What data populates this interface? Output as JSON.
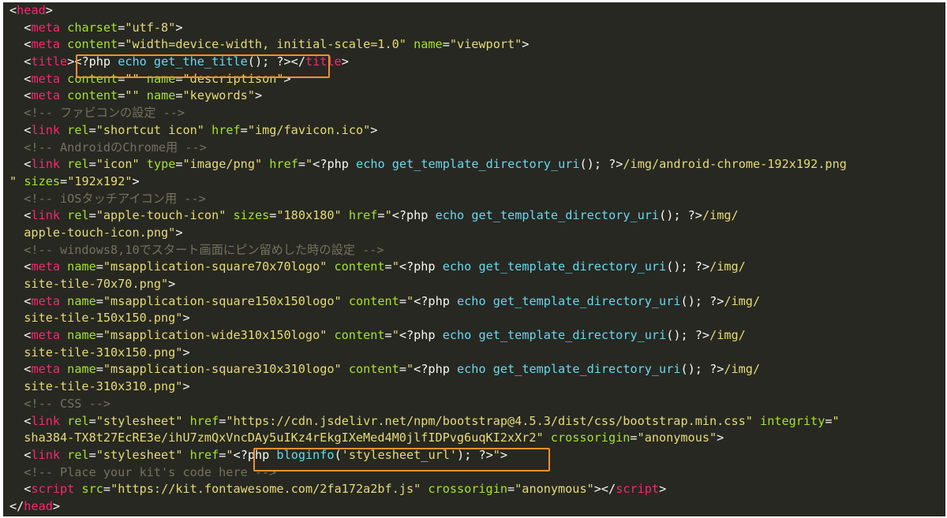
{
  "editor": {
    "lines": [
      [
        {
          "k": "p",
          "v": "<"
        },
        {
          "k": "t",
          "v": "head"
        },
        {
          "k": "p",
          "v": ">"
        }
      ],
      [
        {
          "k": "p",
          "v": "  <"
        },
        {
          "k": "t",
          "v": "meta"
        },
        {
          "k": "p",
          "v": " "
        },
        {
          "k": "a",
          "v": "charset"
        },
        {
          "k": "p",
          "v": "="
        },
        {
          "k": "s",
          "v": "\"utf-8\""
        },
        {
          "k": "p",
          "v": ">"
        }
      ],
      [
        {
          "k": "p",
          "v": "  <"
        },
        {
          "k": "t",
          "v": "meta"
        },
        {
          "k": "p",
          "v": " "
        },
        {
          "k": "a",
          "v": "content"
        },
        {
          "k": "p",
          "v": "="
        },
        {
          "k": "s",
          "v": "\"width=device-width, initial-scale=1.0\""
        },
        {
          "k": "p",
          "v": " "
        },
        {
          "k": "a",
          "v": "name"
        },
        {
          "k": "p",
          "v": "="
        },
        {
          "k": "s",
          "v": "\"viewport\""
        },
        {
          "k": "p",
          "v": ">"
        }
      ],
      [
        {
          "k": "p",
          "v": "  <"
        },
        {
          "k": "t",
          "v": "title"
        },
        {
          "k": "p",
          "v": ">"
        },
        {
          "k": "p",
          "v": "<?php "
        },
        {
          "k": "f",
          "v": "echo"
        },
        {
          "k": "p",
          "v": " "
        },
        {
          "k": "f",
          "v": "get_the_title"
        },
        {
          "k": "p",
          "v": "(); ?>"
        },
        {
          "k": "p",
          "v": "</"
        },
        {
          "k": "t",
          "v": "title"
        },
        {
          "k": "p",
          "v": ">"
        }
      ],
      [
        {
          "k": "p",
          "v": "  <"
        },
        {
          "k": "t",
          "v": "meta"
        },
        {
          "k": "p",
          "v": " "
        },
        {
          "k": "a",
          "v": "content"
        },
        {
          "k": "p",
          "v": "="
        },
        {
          "k": "s",
          "v": "\"\""
        },
        {
          "k": "p",
          "v": " "
        },
        {
          "k": "a",
          "v": "name"
        },
        {
          "k": "p",
          "v": "="
        },
        {
          "k": "s",
          "v": "\"descriptison\""
        },
        {
          "k": "p",
          "v": ">"
        }
      ],
      [
        {
          "k": "p",
          "v": "  <"
        },
        {
          "k": "t",
          "v": "meta"
        },
        {
          "k": "p",
          "v": " "
        },
        {
          "k": "a",
          "v": "content"
        },
        {
          "k": "p",
          "v": "="
        },
        {
          "k": "s",
          "v": "\"\""
        },
        {
          "k": "p",
          "v": " "
        },
        {
          "k": "a",
          "v": "name"
        },
        {
          "k": "p",
          "v": "="
        },
        {
          "k": "s",
          "v": "\"keywords\""
        },
        {
          "k": "p",
          "v": ">"
        }
      ],
      [
        {
          "k": "c",
          "v": "  <!-- ファビコンの設定 -->"
        }
      ],
      [
        {
          "k": "p",
          "v": "  <"
        },
        {
          "k": "t",
          "v": "link"
        },
        {
          "k": "p",
          "v": " "
        },
        {
          "k": "a",
          "v": "rel"
        },
        {
          "k": "p",
          "v": "="
        },
        {
          "k": "s",
          "v": "\"shortcut icon\""
        },
        {
          "k": "p",
          "v": " "
        },
        {
          "k": "a",
          "v": "href"
        },
        {
          "k": "p",
          "v": "="
        },
        {
          "k": "s",
          "v": "\"img/favicon.ico\""
        },
        {
          "k": "p",
          "v": ">"
        }
      ],
      [
        {
          "k": "c",
          "v": "  <!-- AndroidのChrome用 -->"
        }
      ],
      [
        {
          "k": "p",
          "v": "  <"
        },
        {
          "k": "t",
          "v": "link"
        },
        {
          "k": "p",
          "v": " "
        },
        {
          "k": "a",
          "v": "rel"
        },
        {
          "k": "p",
          "v": "="
        },
        {
          "k": "s",
          "v": "\"icon\""
        },
        {
          "k": "p",
          "v": " "
        },
        {
          "k": "a",
          "v": "type"
        },
        {
          "k": "p",
          "v": "="
        },
        {
          "k": "s",
          "v": "\"image/png\""
        },
        {
          "k": "p",
          "v": " "
        },
        {
          "k": "a",
          "v": "href"
        },
        {
          "k": "p",
          "v": "="
        },
        {
          "k": "s",
          "v": "\""
        },
        {
          "k": "p",
          "v": "<?php "
        },
        {
          "k": "f",
          "v": "echo"
        },
        {
          "k": "p",
          "v": " "
        },
        {
          "k": "f",
          "v": "get_template_directory_uri"
        },
        {
          "k": "p",
          "v": "(); ?>"
        },
        {
          "k": "s",
          "v": "/img/android-chrome-192x192.png"
        }
      ],
      [
        {
          "k": "s",
          "v": "\""
        },
        {
          "k": "p",
          "v": " "
        },
        {
          "k": "a",
          "v": "sizes"
        },
        {
          "k": "p",
          "v": "="
        },
        {
          "k": "s",
          "v": "\"192x192\""
        },
        {
          "k": "p",
          "v": ">"
        }
      ],
      [
        {
          "k": "c",
          "v": "  <!-- iOSタッチアイコン用 -->"
        }
      ],
      [
        {
          "k": "p",
          "v": "  <"
        },
        {
          "k": "t",
          "v": "link"
        },
        {
          "k": "p",
          "v": " "
        },
        {
          "k": "a",
          "v": "rel"
        },
        {
          "k": "p",
          "v": "="
        },
        {
          "k": "s",
          "v": "\"apple-touch-icon\""
        },
        {
          "k": "p",
          "v": " "
        },
        {
          "k": "a",
          "v": "sizes"
        },
        {
          "k": "p",
          "v": "="
        },
        {
          "k": "s",
          "v": "\"180x180\""
        },
        {
          "k": "p",
          "v": " "
        },
        {
          "k": "a",
          "v": "href"
        },
        {
          "k": "p",
          "v": "="
        },
        {
          "k": "s",
          "v": "\""
        },
        {
          "k": "p",
          "v": "<?php "
        },
        {
          "k": "f",
          "v": "echo"
        },
        {
          "k": "p",
          "v": " "
        },
        {
          "k": "f",
          "v": "get_template_directory_uri"
        },
        {
          "k": "p",
          "v": "(); ?>"
        },
        {
          "k": "s",
          "v": "/img/"
        }
      ],
      [
        {
          "k": "s",
          "v": "  apple-touch-icon.png\""
        },
        {
          "k": "p",
          "v": ">"
        }
      ],
      [
        {
          "k": "c",
          "v": "  <!-- windows8,10でスタート画面にピン留めした時の設定 -->"
        }
      ],
      [
        {
          "k": "p",
          "v": "  <"
        },
        {
          "k": "t",
          "v": "meta"
        },
        {
          "k": "p",
          "v": " "
        },
        {
          "k": "a",
          "v": "name"
        },
        {
          "k": "p",
          "v": "="
        },
        {
          "k": "s",
          "v": "\"msapplication-square70x70logo\""
        },
        {
          "k": "p",
          "v": " "
        },
        {
          "k": "a",
          "v": "content"
        },
        {
          "k": "p",
          "v": "="
        },
        {
          "k": "s",
          "v": "\""
        },
        {
          "k": "p",
          "v": "<?php "
        },
        {
          "k": "f",
          "v": "echo"
        },
        {
          "k": "p",
          "v": " "
        },
        {
          "k": "f",
          "v": "get_template_directory_uri"
        },
        {
          "k": "p",
          "v": "(); ?>"
        },
        {
          "k": "s",
          "v": "/img/"
        }
      ],
      [
        {
          "k": "s",
          "v": "  site-tile-70x70.png\""
        },
        {
          "k": "p",
          "v": ">"
        }
      ],
      [
        {
          "k": "p",
          "v": "  <"
        },
        {
          "k": "t",
          "v": "meta"
        },
        {
          "k": "p",
          "v": " "
        },
        {
          "k": "a",
          "v": "name"
        },
        {
          "k": "p",
          "v": "="
        },
        {
          "k": "s",
          "v": "\"msapplication-square150x150logo\""
        },
        {
          "k": "p",
          "v": " "
        },
        {
          "k": "a",
          "v": "content"
        },
        {
          "k": "p",
          "v": "="
        },
        {
          "k": "s",
          "v": "\""
        },
        {
          "k": "p",
          "v": "<?php "
        },
        {
          "k": "f",
          "v": "echo"
        },
        {
          "k": "p",
          "v": " "
        },
        {
          "k": "f",
          "v": "get_template_directory_uri"
        },
        {
          "k": "p",
          "v": "(); ?>"
        },
        {
          "k": "s",
          "v": "/img/"
        }
      ],
      [
        {
          "k": "s",
          "v": "  site-tile-150x150.png\""
        },
        {
          "k": "p",
          "v": ">"
        }
      ],
      [
        {
          "k": "p",
          "v": "  <"
        },
        {
          "k": "t",
          "v": "meta"
        },
        {
          "k": "p",
          "v": " "
        },
        {
          "k": "a",
          "v": "name"
        },
        {
          "k": "p",
          "v": "="
        },
        {
          "k": "s",
          "v": "\"msapplication-wide310x150logo\""
        },
        {
          "k": "p",
          "v": " "
        },
        {
          "k": "a",
          "v": "content"
        },
        {
          "k": "p",
          "v": "="
        },
        {
          "k": "s",
          "v": "\""
        },
        {
          "k": "p",
          "v": "<?php "
        },
        {
          "k": "f",
          "v": "echo"
        },
        {
          "k": "p",
          "v": " "
        },
        {
          "k": "f",
          "v": "get_template_directory_uri"
        },
        {
          "k": "p",
          "v": "(); ?>"
        },
        {
          "k": "s",
          "v": "/img/"
        }
      ],
      [
        {
          "k": "s",
          "v": "  site-tile-310x150.png\""
        },
        {
          "k": "p",
          "v": ">"
        }
      ],
      [
        {
          "k": "p",
          "v": "  <"
        },
        {
          "k": "t",
          "v": "meta"
        },
        {
          "k": "p",
          "v": " "
        },
        {
          "k": "a",
          "v": "name"
        },
        {
          "k": "p",
          "v": "="
        },
        {
          "k": "s",
          "v": "\"msapplication-square310x310logo\""
        },
        {
          "k": "p",
          "v": " "
        },
        {
          "k": "a",
          "v": "content"
        },
        {
          "k": "p",
          "v": "="
        },
        {
          "k": "s",
          "v": "\""
        },
        {
          "k": "p",
          "v": "<?php "
        },
        {
          "k": "f",
          "v": "echo"
        },
        {
          "k": "p",
          "v": " "
        },
        {
          "k": "f",
          "v": "get_template_directory_uri"
        },
        {
          "k": "p",
          "v": "(); ?>"
        },
        {
          "k": "s",
          "v": "/img/"
        }
      ],
      [
        {
          "k": "s",
          "v": "  site-tile-310x310.png\""
        },
        {
          "k": "p",
          "v": ">"
        }
      ],
      [
        {
          "k": "c",
          "v": "  <!-- CSS -->"
        }
      ],
      [
        {
          "k": "p",
          "v": "  <"
        },
        {
          "k": "t",
          "v": "link"
        },
        {
          "k": "p",
          "v": " "
        },
        {
          "k": "a",
          "v": "rel"
        },
        {
          "k": "p",
          "v": "="
        },
        {
          "k": "s",
          "v": "\"stylesheet\""
        },
        {
          "k": "p",
          "v": " "
        },
        {
          "k": "a",
          "v": "href"
        },
        {
          "k": "p",
          "v": "="
        },
        {
          "k": "s",
          "v": "\"https://cdn.jsdelivr.net/npm/bootstrap@4.5.3/dist/css/bootstrap.min.css\""
        },
        {
          "k": "p",
          "v": " "
        },
        {
          "k": "a",
          "v": "integrity"
        },
        {
          "k": "p",
          "v": "="
        },
        {
          "k": "s",
          "v": "\""
        }
      ],
      [
        {
          "k": "s",
          "v": "  sha384-TX8t27EcRE3e/ihU7zmQxVncDAy5uIKz4rEkgIXeMed4M0jlfIDPvg6uqKI2xXr2\""
        },
        {
          "k": "p",
          "v": " "
        },
        {
          "k": "a",
          "v": "crossorigin"
        },
        {
          "k": "p",
          "v": "="
        },
        {
          "k": "s",
          "v": "\"anonymous\""
        },
        {
          "k": "p",
          "v": ">"
        }
      ],
      [
        {
          "k": "p",
          "v": "  <"
        },
        {
          "k": "t",
          "v": "link"
        },
        {
          "k": "p",
          "v": " "
        },
        {
          "k": "a",
          "v": "rel"
        },
        {
          "k": "p",
          "v": "="
        },
        {
          "k": "s",
          "v": "\"stylesheet\""
        },
        {
          "k": "p",
          "v": " "
        },
        {
          "k": "a",
          "v": "href"
        },
        {
          "k": "p",
          "v": "="
        },
        {
          "k": "s",
          "v": "\""
        },
        {
          "k": "p",
          "v": "<?php "
        },
        {
          "k": "f",
          "v": "bloginfo"
        },
        {
          "k": "p",
          "v": "("
        },
        {
          "k": "s",
          "v": "'stylesheet_url'"
        },
        {
          "k": "p",
          "v": "); ?>"
        },
        {
          "k": "s",
          "v": "\""
        },
        {
          "k": "p",
          "v": ">"
        }
      ],
      [
        {
          "k": "c",
          "v": "  <!-- Place your kit's code here -->"
        }
      ],
      [
        {
          "k": "p",
          "v": "  <"
        },
        {
          "k": "t",
          "v": "script"
        },
        {
          "k": "p",
          "v": " "
        },
        {
          "k": "a",
          "v": "src"
        },
        {
          "k": "p",
          "v": "="
        },
        {
          "k": "s",
          "v": "\"https://kit.fontawesome.com/2fa172a2bf.js\""
        },
        {
          "k": "p",
          "v": " "
        },
        {
          "k": "a",
          "v": "crossorigin"
        },
        {
          "k": "p",
          "v": "="
        },
        {
          "k": "s",
          "v": "\"anonymous\""
        },
        {
          "k": "p",
          "v": "></"
        },
        {
          "k": "t",
          "v": "script"
        },
        {
          "k": "p",
          "v": ">"
        }
      ],
      [
        {
          "k": "p",
          "v": "</"
        },
        {
          "k": "t",
          "v": "head"
        },
        {
          "k": "p",
          "v": ">"
        }
      ]
    ]
  },
  "colors": {
    "background": "#272822",
    "tag": "#f92672",
    "attribute": "#a6e22e",
    "string": "#e6db74",
    "comment": "#75715e",
    "function": "#66d9ef",
    "highlight": "#f0912f"
  }
}
